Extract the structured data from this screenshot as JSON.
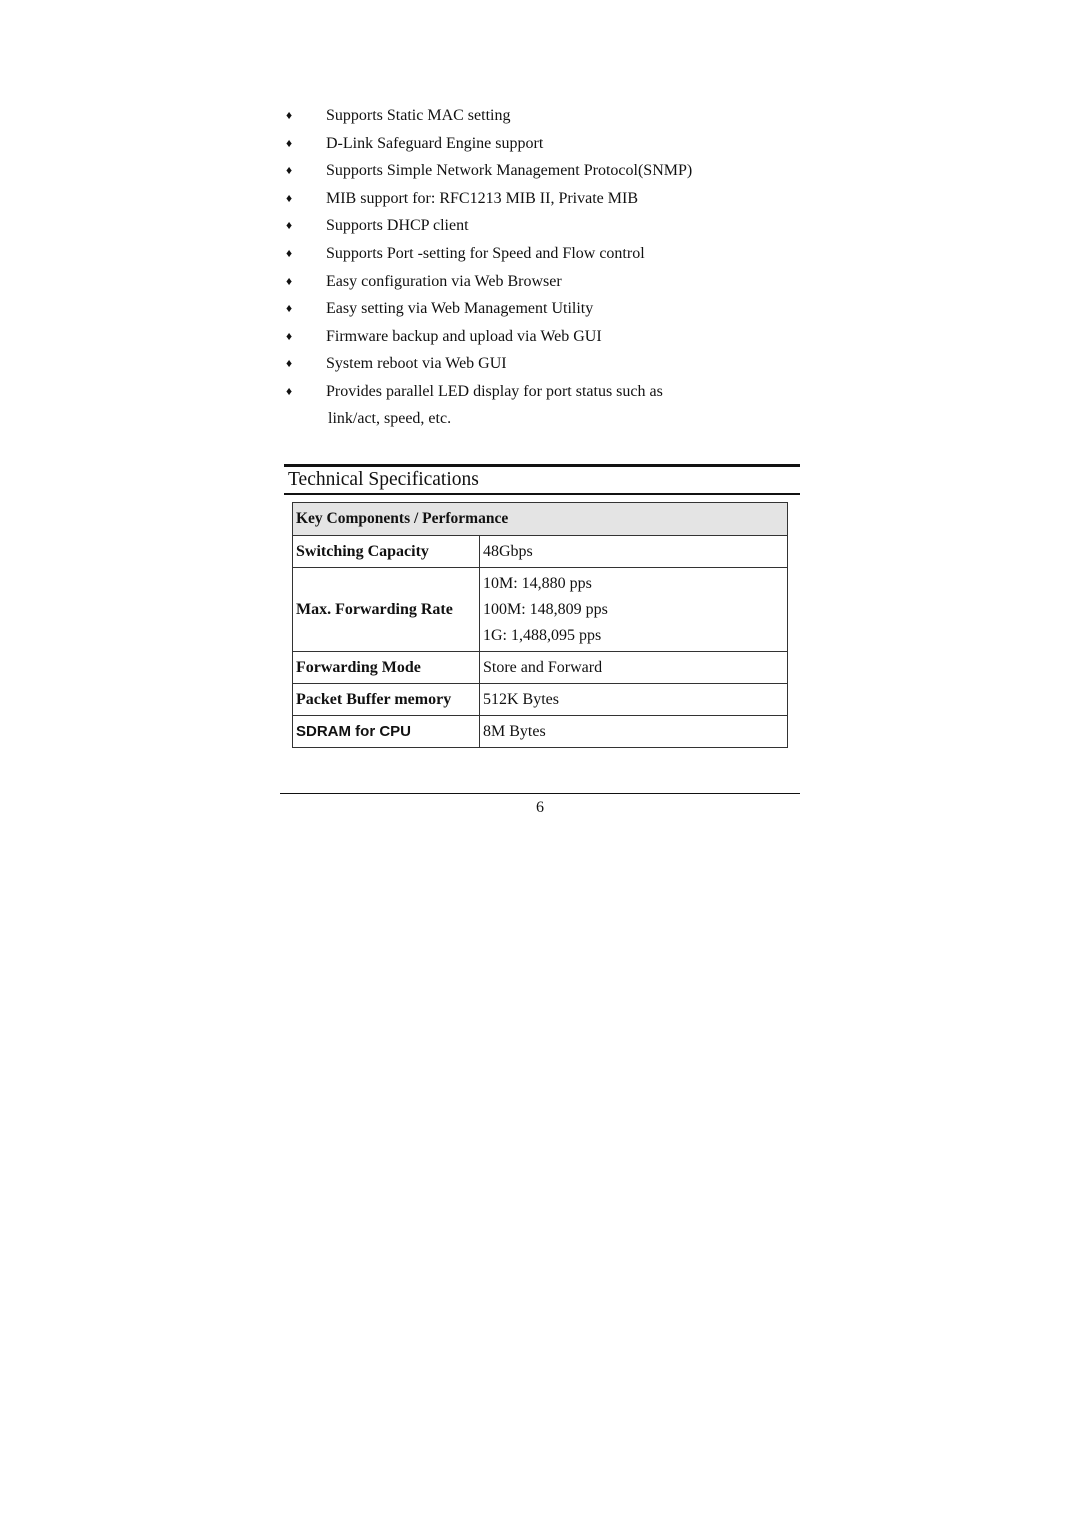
{
  "features": {
    "bullet_icon": "diamond-bullet",
    "bullet_glyph": "♦",
    "items": [
      {
        "text": "Supports Static MAC setting"
      },
      {
        "text": "D-Link Safeguard Engine support"
      },
      {
        "text": "Supports Simple Network Management Protocol(SNMP)"
      },
      {
        "text": "MIB support for: RFC1213 MIB II, Private MIB"
      },
      {
        "text": "Supports DHCP client"
      },
      {
        "text": "Supports Port -setting for Speed and Flow control"
      },
      {
        "text": "Easy configuration via Web Browser"
      },
      {
        "text": "Easy setting via Web Management Utility"
      },
      {
        "text": "Firmware backup and upload via Web GUI"
      },
      {
        "text": "System reboot via Web GUI"
      },
      {
        "text": "Provides parallel LED display for port status such as",
        "continuation": "link/act, speed, etc."
      }
    ]
  },
  "section": {
    "title": "Technical Specifications"
  },
  "spec_table": {
    "header": "Key Components / Performance",
    "header_bg": "#e4e4e4",
    "rows": [
      {
        "label": "Switching Capacity",
        "values": [
          "48Gbps"
        ]
      },
      {
        "label": "Max. Forwarding Rate",
        "values": [
          "10M: 14,880 pps",
          "100M: 148,809 pps",
          "1G: 1,488,095 pps"
        ]
      },
      {
        "label": "Forwarding Mode",
        "values": [
          "Store and Forward"
        ]
      },
      {
        "label": "Packet Buffer memory",
        "values": [
          "512K Bytes"
        ]
      },
      {
        "label": "SDRAM for CPU",
        "values": [
          "8M Bytes"
        ]
      }
    ]
  },
  "footer": {
    "page_number": "6"
  }
}
